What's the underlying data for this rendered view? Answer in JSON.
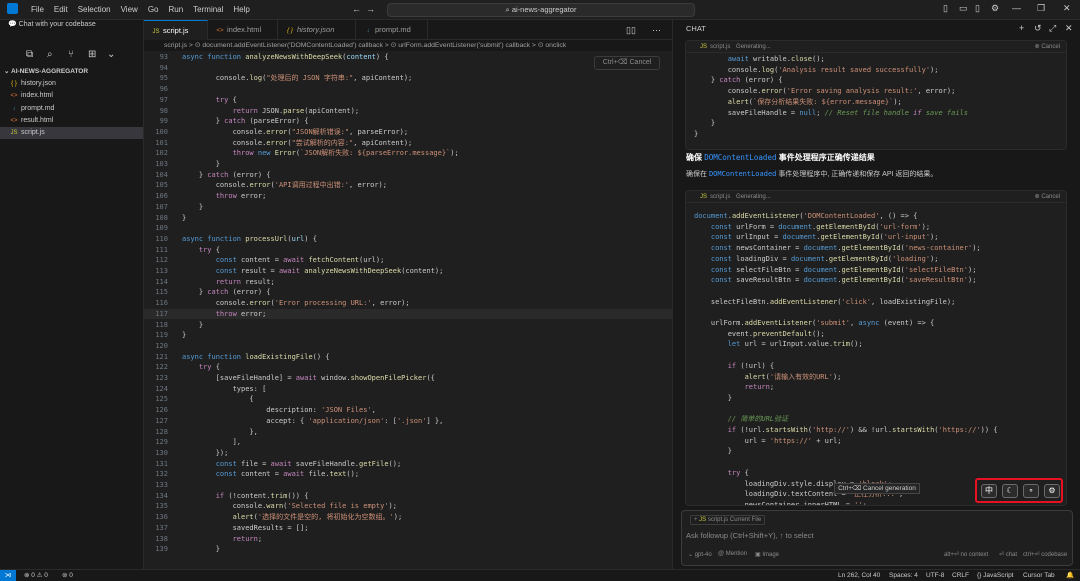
{
  "titlebar": {
    "menu": [
      "File",
      "Edit",
      "Selection",
      "View",
      "Go",
      "Run",
      "Terminal",
      "Help"
    ],
    "search": "ai-news-aggregator"
  },
  "sidebar": {
    "chat_label": "Chat with your codebase",
    "root": "AI-NEWS-AGGREGATOR",
    "files": [
      {
        "name": "history.json",
        "icon": "{ }",
        "color": "#f1c40f"
      },
      {
        "name": "index.html",
        "icon": "<>",
        "color": "#e37933"
      },
      {
        "name": "prompt.md",
        "icon": "↓",
        "color": "#519aba"
      },
      {
        "name": "result.html",
        "icon": "<>",
        "color": "#e37933"
      },
      {
        "name": "script.js",
        "icon": "JS",
        "color": "#cbcb41"
      }
    ]
  },
  "tabs": [
    {
      "label": "script.js",
      "icon": "JS",
      "color": "#cbcb41"
    },
    {
      "label": "index.html",
      "icon": "<>",
      "color": "#e37933"
    },
    {
      "label": "history.json",
      "icon": "{ }",
      "color": "#f1c40f"
    },
    {
      "label": "prompt.md",
      "icon": "↓",
      "color": "#519aba"
    }
  ],
  "breadcrumb": "script.js > ⊙ document.addEventListener('DOMContentLoaded') callback > ⊙ urlForm.addEventListener('submit') callback > ⊙ onclick",
  "cancel_hint": "Ctrl+⌫ Cancel",
  "code_lines": [
    {
      "n": "93",
      "html": "<span class='k'>async function</span> <span class='f'>analyzeNewsWithDeepSeek</span>(<span class='v'>content</span>) {"
    },
    {
      "n": "94",
      "html": ""
    },
    {
      "n": "95",
      "html": "        console.<span class='f'>log</span>(<span class='s'>\"处理后的 JSON 字符串:\"</span>, apiContent);"
    },
    {
      "n": "96",
      "html": ""
    },
    {
      "n": "97",
      "html": "        <span class='p'>try</span> {"
    },
    {
      "n": "98",
      "html": "            <span class='p'>return</span> JSON.<span class='f'>parse</span>(apiContent);"
    },
    {
      "n": "99",
      "html": "        } <span class='p'>catch</span> (parseError) {"
    },
    {
      "n": "100",
      "html": "            console.<span class='f'>error</span>(<span class='s'>\"JSON解析错误:\"</span>, parseError);"
    },
    {
      "n": "101",
      "html": "            console.<span class='f'>error</span>(<span class='s'>\"尝试解析的内容:\"</span>, apiContent);"
    },
    {
      "n": "102",
      "html": "            <span class='p'>throw</span> <span class='k'>new</span> <span class='f'>Error</span>(<span class='s'>`JSON解析失败: ${parseError.message}`</span>);"
    },
    {
      "n": "103",
      "html": "        }"
    },
    {
      "n": "104",
      "html": "    } <span class='p'>catch</span> (error) {"
    },
    {
      "n": "105",
      "html": "        console.<span class='f'>error</span>(<span class='s'>'API调用过程中出错:'</span>, error);"
    },
    {
      "n": "106",
      "html": "        <span class='p'>throw</span> error;"
    },
    {
      "n": "107",
      "html": "    }"
    },
    {
      "n": "108",
      "html": "}"
    },
    {
      "n": "109",
      "html": ""
    },
    {
      "n": "110",
      "html": "<span class='k'>async function</span> <span class='f'>processUrl</span>(<span class='v'>url</span>) {"
    },
    {
      "n": "111",
      "html": "    <span class='p'>try</span> {"
    },
    {
      "n": "112",
      "html": "        <span class='k'>const</span> content = <span class='p'>await</span> <span class='f'>fetchContent</span>(url);"
    },
    {
      "n": "113",
      "html": "        <span class='k'>const</span> result = <span class='p'>await</span> <span class='f'>analyzeNewsWithDeepSeek</span>(content);"
    },
    {
      "n": "114",
      "html": "        <span class='p'>return</span> result;"
    },
    {
      "n": "115",
      "html": "    } <span class='p'>catch</span> (error) {"
    },
    {
      "n": "116",
      "html": "        console.<span class='f'>error</span>(<span class='s'>'Error processing URL:'</span>, error);"
    },
    {
      "n": "117",
      "html": "        <span class='p'>throw</span> error;"
    },
    {
      "n": "118",
      "html": "    }"
    },
    {
      "n": "119",
      "html": "}"
    },
    {
      "n": "120",
      "html": ""
    },
    {
      "n": "121",
      "html": "<span class='k'>async function</span> <span class='f'>loadExistingFile</span>() {"
    },
    {
      "n": "122",
      "html": "    <span class='p'>try</span> {"
    },
    {
      "n": "123",
      "html": "        [saveFileHandle] = <span class='p'>await</span> window.<span class='f'>showOpenFilePicker</span>({"
    },
    {
      "n": "124",
      "html": "            types: ["
    },
    {
      "n": "125",
      "html": "                {"
    },
    {
      "n": "126",
      "html": "                    description: <span class='s'>'JSON Files'</span>,"
    },
    {
      "n": "127",
      "html": "                    accept: { <span class='s'>'application/json'</span>: [<span class='s'>'.json'</span>] },"
    },
    {
      "n": "128",
      "html": "                },"
    },
    {
      "n": "129",
      "html": "            ],"
    },
    {
      "n": "130",
      "html": "        });"
    },
    {
      "n": "131",
      "html": "        <span class='k'>const</span> file = <span class='p'>await</span> saveFileHandle.<span class='f'>getFile</span>();"
    },
    {
      "n": "132",
      "html": "        <span class='k'>const</span> content = <span class='p'>await</span> file.<span class='f'>text</span>();"
    },
    {
      "n": "133",
      "html": ""
    },
    {
      "n": "134",
      "html": "        <span class='p'>if</span> (!content.<span class='f'>trim</span>()) {"
    },
    {
      "n": "135",
      "html": "            console.<span class='f'>warn</span>(<span class='s'>'Selected file is empty'</span>);"
    },
    {
      "n": "136",
      "html": "            <span class='f'>alert</span>(<span class='s'>'选择的文件是空的, 将初始化为空数组。'</span>);"
    },
    {
      "n": "137",
      "html": "            savedResults = [];"
    },
    {
      "n": "138",
      "html": "            <span class='p'>return</span>;"
    },
    {
      "n": "139",
      "html": "        }"
    }
  ],
  "chat": {
    "header": "CHAT",
    "block1": {
      "file": "script.js",
      "status": "Generating...",
      "cancel": "Cancel",
      "lines": [
        "        await writable.close();",
        "        console.log('Analysis result saved successfully');",
        "    } catch (error) {",
        "        console.error('Error saving analysis result:', error);",
        "        alert(`保存分析结果失败: ${error.message}`);",
        "        saveFileHandle = null; // Reset file handle if save fails",
        "    }",
        "}"
      ]
    },
    "heading_prefix": "确保 ",
    "heading_code": "DOMContentLoaded",
    "heading_suffix": " 事件处理程序正确传递结果",
    "desc_prefix": "确保在 ",
    "desc_code": "DOMContentLoaded",
    "desc_suffix": " 事件处理程序中, 正确传递和保存 API 返回的结果。",
    "block2": {
      "file": "script.js",
      "status": "Generating...",
      "cancel": "Cancel",
      "lines": [
        "document.addEventListener('DOMContentLoaded', () => {",
        "    const urlForm = document.getElementById('url-form');",
        "    const urlInput = document.getElementById('url-input');",
        "    const newsContainer = document.getElementById('news-container');",
        "    const loadingDiv = document.getElementById('loading');",
        "    const selectFileBtn = document.getElementById('selectFileBtn');",
        "    const saveResultBtn = document.getElementById('saveResultBtn');",
        "",
        "    selectFileBtn.addEventListener('click', loadExistingFile);",
        "",
        "    urlForm.addEventListener('submit', async (event) => {",
        "        event.preventDefault();",
        "        let url = urlInput.value.trim();",
        "",
        "        if (!url) {",
        "            alert('请输入有效的URL');",
        "            return;",
        "        }",
        "",
        "        // 简单的URL验证",
        "        if (!url.startsWith('http://') && !url.startsWith('https://')) {",
        "            url = 'https://' + url;",
        "        }",
        "",
        "        try {",
        "            loadingDiv.style.display = 'block';",
        "            loadingDiv.textContent = '正在分析...';",
        "            newsContainer.innerHTML = '';"
      ]
    },
    "tooltip": "Ctrl+⌫ Cancel generation",
    "float_buttons": [
      "中",
      "☾",
      "∘",
      "⚙"
    ],
    "input": {
      "context_chip": "script.js",
      "context_sub": "Current File",
      "placeholder": "Ask followup (Ctrl+Shift+Y), ↑ to select",
      "model": "gpt-4o",
      "mention": "@ Mention",
      "image": "Image",
      "no_context": "alt+⏎ no context",
      "chat": "⏎ chat",
      "codebase": "ctrl+⏎ codebase"
    }
  },
  "status": {
    "errors": "⊗ 0 ⚠ 0",
    "ports": "⊚ 0",
    "position": "Ln 262, Col 40",
    "spaces": "Spaces: 4",
    "encoding": "UTF-8",
    "eol": "CRLF",
    "language": "{} JavaScript",
    "tab": "Cursor Tab"
  }
}
